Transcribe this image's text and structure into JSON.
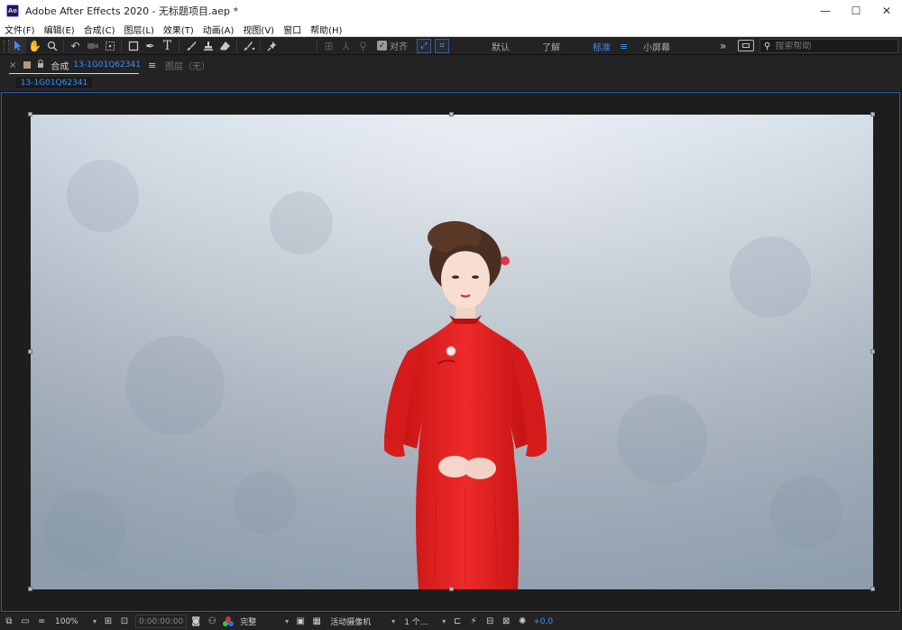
{
  "window": {
    "app_logo": "Ae",
    "title": "Adobe After Effects 2020 - 无标题项目.aep *",
    "controls": {
      "minimize": "—",
      "maximize": "☐",
      "close": "✕"
    }
  },
  "menu": [
    "文件(F)",
    "编辑(E)",
    "合成(C)",
    "图层(L)",
    "效果(T)",
    "动画(A)",
    "视图(V)",
    "窗口",
    "帮助(H)"
  ],
  "toolbar": {
    "tools": [
      "selection-tool",
      "hand-tool",
      "zoom-tool",
      "rotate-tool",
      "camera-tool",
      "pan-behind-tool",
      "rectangle-tool",
      "pen-tool",
      "type-tool",
      "brush-tool",
      "clone-stamp-tool",
      "eraser-tool",
      "roto-brush-tool",
      "puppet-pin-tool"
    ],
    "snap_label": "对齐",
    "workspaces": [
      "默认",
      "了解",
      "标准",
      "小屏幕"
    ],
    "active_workspace": "标准",
    "more": "»",
    "search_placeholder": "搜索帮助"
  },
  "panel": {
    "close": "×",
    "lock": "🔒",
    "title": "合成",
    "comp_name": "13-1G01Q62341",
    "menu": "≡",
    "layer_tab": "图层（无）"
  },
  "navigator": {
    "comp_pill": "13-1G01Q62341"
  },
  "viewer_bar": {
    "zoom": "100%",
    "timecode": "0:00:00:00",
    "resolution": "完整",
    "camera": "活动摄像机",
    "views": "1 个...",
    "exposure": "+0.0",
    "chevron": "▾"
  },
  "colors": {
    "accent": "#3d8fff",
    "panel_bg": "#232323",
    "viewer_border": "#2f5fa8",
    "dress": "#e02020",
    "backdrop": "#c9d6e2"
  }
}
